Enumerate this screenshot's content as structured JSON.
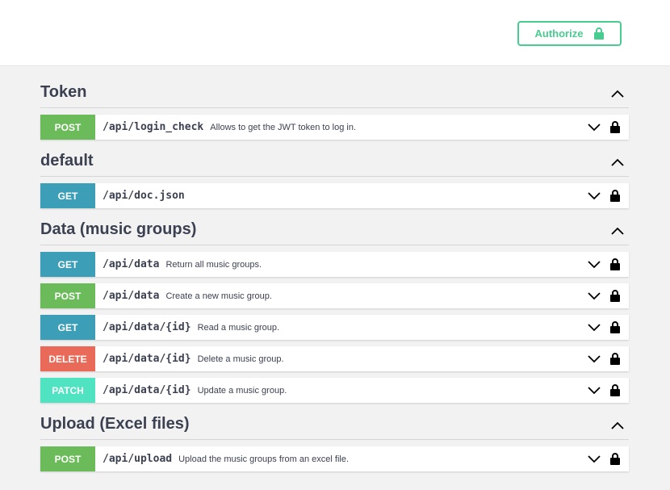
{
  "topbar": {
    "authorize_label": "Authorize",
    "accent": "#49cc90"
  },
  "colors": {
    "GET": "#3d9fb7",
    "POST": "#6cbb5a",
    "DELETE": "#ea6a5a",
    "PATCH": "#50e3c2"
  },
  "sections": [
    {
      "title": "Token",
      "operations": [
        {
          "method": "POST",
          "path": "/api/login_check",
          "description": "Allows to get the JWT token to log in."
        }
      ]
    },
    {
      "title": "default",
      "operations": [
        {
          "method": "GET",
          "path": "/api/doc.json",
          "description": ""
        }
      ]
    },
    {
      "title": "Data (music groups)",
      "operations": [
        {
          "method": "GET",
          "path": "/api/data",
          "description": "Return all music groups."
        },
        {
          "method": "POST",
          "path": "/api/data",
          "description": "Create a new music group."
        },
        {
          "method": "GET",
          "path": "/api/data/{id}",
          "description": "Read a music group."
        },
        {
          "method": "DELETE",
          "path": "/api/data/{id}",
          "description": "Delete a music group."
        },
        {
          "method": "PATCH",
          "path": "/api/data/{id}",
          "description": "Update a music group."
        }
      ]
    },
    {
      "title": "Upload (Excel files)",
      "operations": [
        {
          "method": "POST",
          "path": "/api/upload",
          "description": "Upload the music groups from an excel file."
        }
      ]
    }
  ],
  "icons": {
    "authorize": "lock-open-icon",
    "section_toggle": "chevron-up-icon",
    "op_expand": "chevron-down-icon",
    "op_lock": "lock-icon"
  }
}
